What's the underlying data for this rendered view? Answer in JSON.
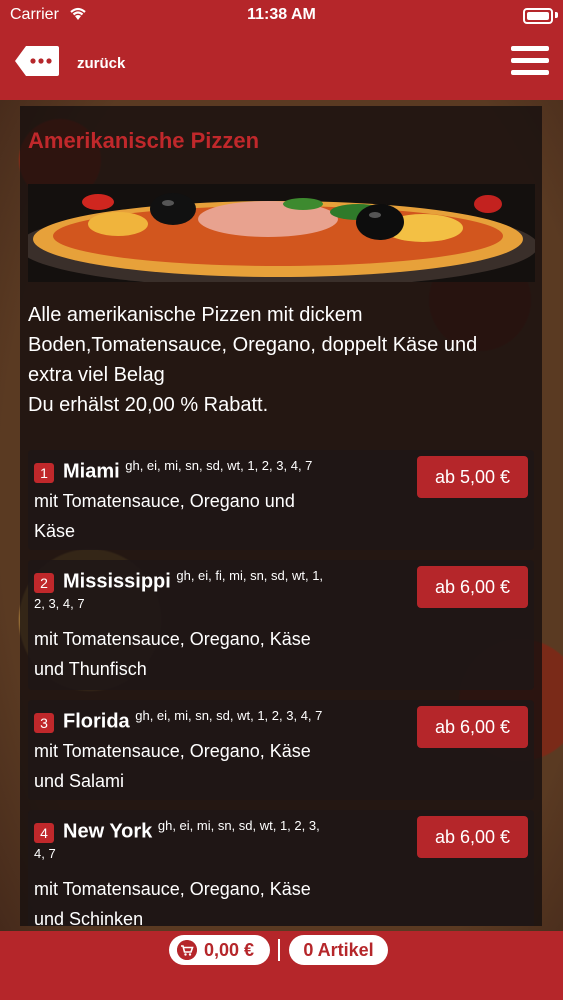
{
  "status_bar": {
    "carrier": "Carrier",
    "time": "11:38 AM"
  },
  "nav": {
    "back_label": "zurück",
    "back_icon": "ellipsis-tag-icon",
    "menu_icon": "hamburger-menu-icon"
  },
  "category": {
    "title": "Amerikanische Pizzen",
    "description_lines": [
      "Alle amerikanische Pizzen mit dickem",
      "Boden,Tomatensauce, Oregano, doppelt Käse und",
      "extra viel Belag",
      "Du erhälst 20,00 % Rabatt."
    ]
  },
  "items": [
    {
      "number": "1",
      "name": "Miami",
      "allergens": "gh, ei, mi, sn, sd, wt, 1, 2, 3, 4, 7",
      "allergens_wrap": "",
      "desc_lines": [
        "mit Tomatensauce, Oregano und",
        "Käse"
      ],
      "price": "ab 5,00 €"
    },
    {
      "number": "2",
      "name": "Mississippi",
      "allergens": "gh, ei, fi, mi, sn, sd, wt, 1,",
      "allergens_wrap": "2, 3, 4, 7",
      "desc_lines": [
        "mit Tomatensauce, Oregano, Käse",
        "und Thunfisch"
      ],
      "price": "ab 6,00 €"
    },
    {
      "number": "3",
      "name": "Florida",
      "allergens": "gh, ei, mi, sn, sd, wt, 1, 2, 3, 4, 7",
      "allergens_wrap": "",
      "desc_lines": [
        "mit Tomatensauce, Oregano, Käse",
        "und Salami"
      ],
      "price": "ab 6,00 €"
    },
    {
      "number": "4",
      "name": "New York",
      "allergens": "gh, ei, mi, sn, sd, wt, 1, 2, 3,",
      "allergens_wrap": "4, 7",
      "desc_lines": [
        "mit Tomatensauce, Oregano, Käse",
        "und Schinken"
      ],
      "price": "ab 6,00 €"
    }
  ],
  "footer": {
    "cart_total": "0,00 €",
    "cart_icon": "shopping-cart-icon",
    "article_count": "0 Artikel"
  },
  "colors": {
    "accent": "#b5262a",
    "title": "#c0282b"
  }
}
